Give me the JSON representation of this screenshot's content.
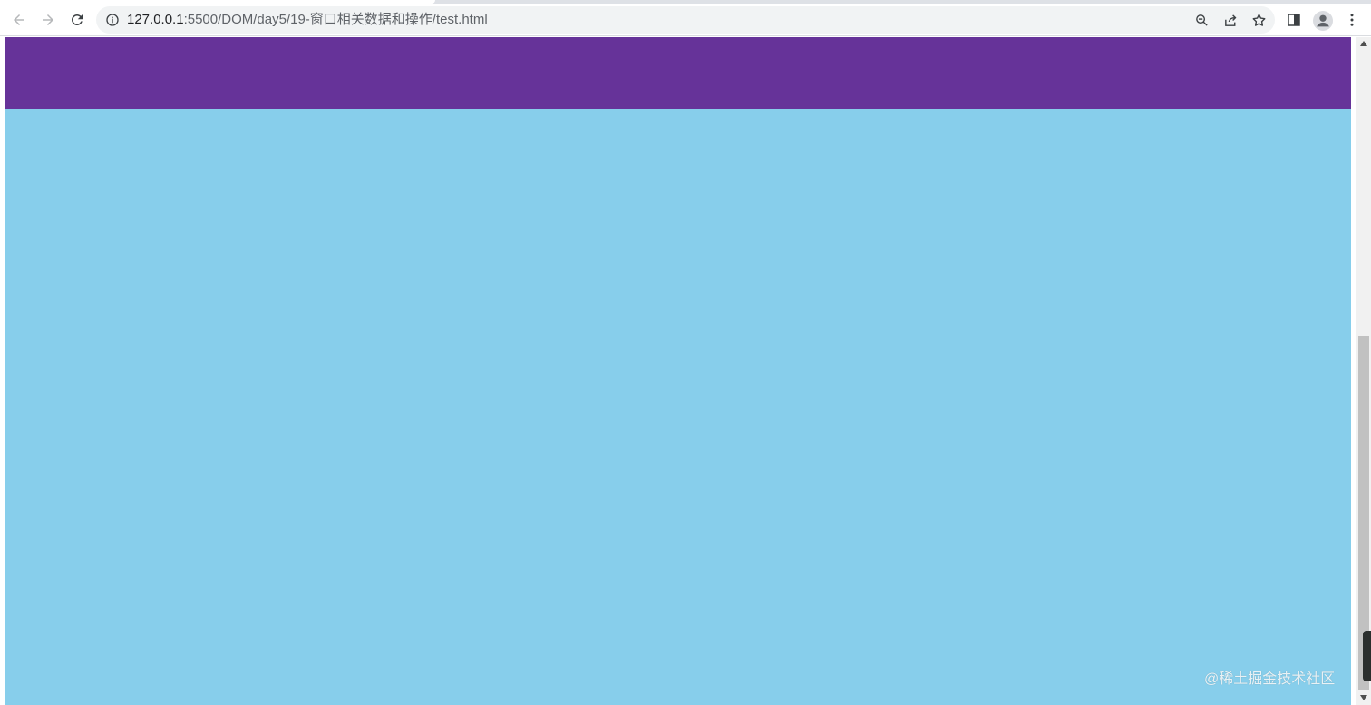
{
  "browser": {
    "url_host": "127.0.0.1",
    "url_path": ":5500/DOM/day5/19-窗口相关数据和操作/test.html",
    "nav": {
      "back_icon": "arrow-left-icon",
      "forward_icon": "arrow-right-icon",
      "reload_icon": "reload-icon"
    },
    "omnibox_actions": [
      "zoom-out-icon",
      "share-icon",
      "star-icon"
    ],
    "toolbar_actions": [
      "side-panel-icon",
      "profile-avatar",
      "more-menu-icon"
    ]
  },
  "page": {
    "header_color": "#663399",
    "content_color": "#87ceeb"
  },
  "watermark": "@稀土掘金技术社区"
}
